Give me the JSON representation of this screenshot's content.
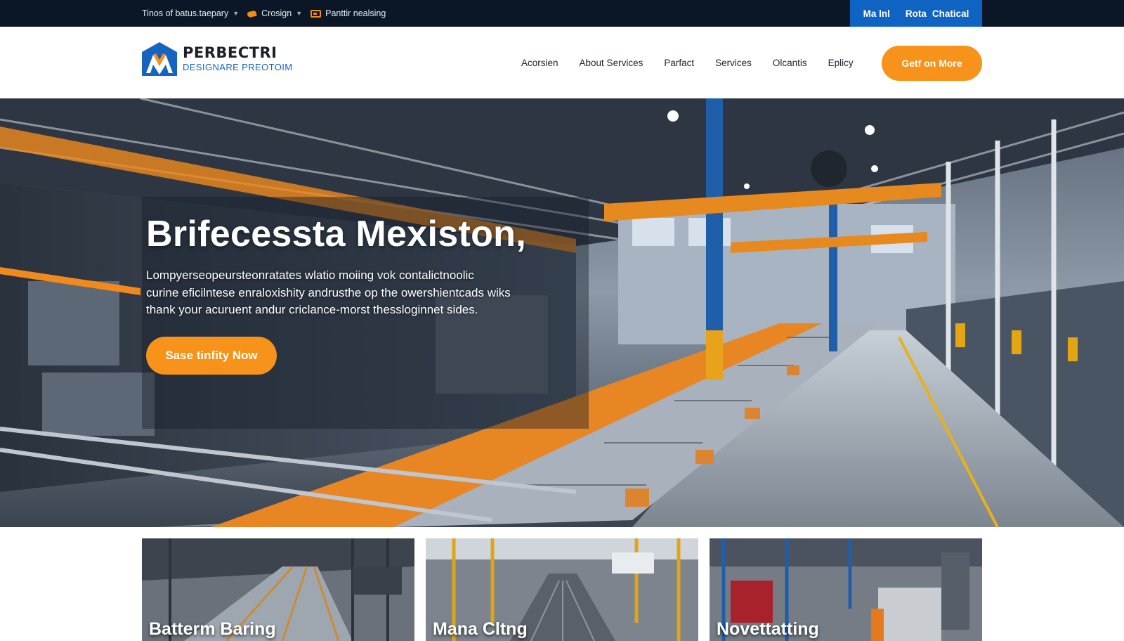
{
  "topbar": {
    "links": [
      {
        "label": "Tinos of batus.taepary",
        "icon": "chevron-down-icon"
      },
      {
        "label": "Crosign",
        "icon": "bird-icon"
      },
      {
        "label": "Panttir nealsing",
        "icon": "promo-icon"
      }
    ],
    "right": [
      "Ma lnl",
      "Rota",
      "Chatical"
    ]
  },
  "brand": {
    "title": "PERBECTRI",
    "subtitle": "DESIGNARE PREOTOIM",
    "colors": {
      "blue": "#1565c0",
      "orange": "#f7921a",
      "dark": "#0b1726"
    }
  },
  "nav": {
    "items": [
      "Acorsien",
      "About Services",
      "Parfact",
      "Services",
      "Olcantis",
      "Eplicy"
    ],
    "cta": "Getf on More"
  },
  "hero": {
    "title": "Brifecessta Mexiston,",
    "body": [
      "Lompyerseopeursteonratates wlatio moiing vok contalictnoolic",
      "curine eficilntese enraloxishity andrusthe op the owershientcads wiks",
      "thank your acuruent andur criclance-morst thessloginnet sides."
    ],
    "cta": "Sase tinfity Now"
  },
  "cards": [
    {
      "title": "Batterm Baring"
    },
    {
      "title": "Mana Cltng"
    },
    {
      "title": "Novettatting"
    }
  ]
}
